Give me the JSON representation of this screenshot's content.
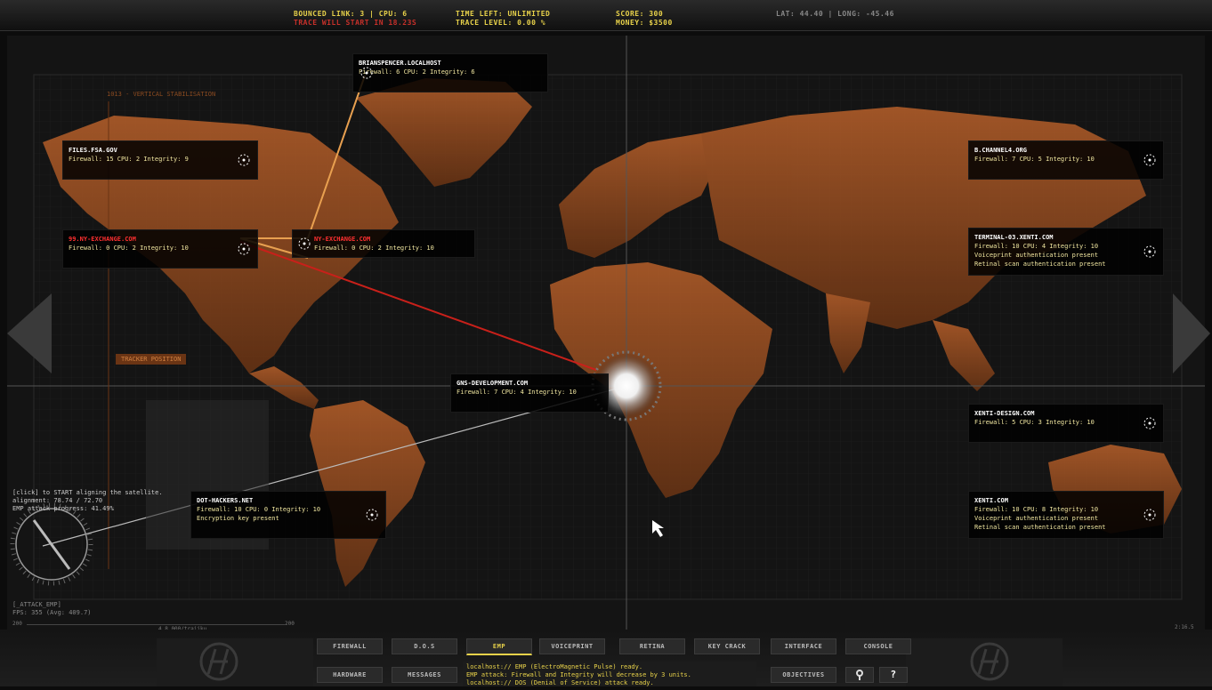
{
  "top": {
    "bounced": "BOUNCED LINK: 3 | CPU: 6",
    "trace_warn": "TRACE WILL START IN 18.23S",
    "time_left": "TIME LEFT: UNLIMITED",
    "trace_level": "TRACE LEVEL: 0.00 %",
    "score": "SCORE: 300",
    "money": "MONEY: $3500",
    "coords": "LAT: 44.40 | LONG: -45.46"
  },
  "map_title": "1013 - VERTICAL STABILISATION",
  "tracker": "TRACKER POSITION",
  "hosts": [
    {
      "name": "BRIANSPENCER.LOCALHOST",
      "lines": [
        "Firewall: 6 CPU: 2 Integrity: 6"
      ]
    },
    {
      "name": "FILES.FSA.GOV",
      "lines": [
        "Firewall: 15 CPU: 2 Integrity: 9"
      ]
    },
    {
      "name": "99.NY-EXCHANGE.COM",
      "lines": [
        "Firewall: 0 CPU: 2 Integrity: 10"
      ]
    },
    {
      "name": "NY-EXCHANGE.COM",
      "lines": [
        "Firewall: 0 CPU: 2 Integrity: 10"
      ]
    },
    {
      "name": "GNS-DEVELOPMENT.COM",
      "lines": [
        "Firewall: 7 CPU: 4 Integrity: 10"
      ]
    },
    {
      "name": "DOT-HACKERS.NET",
      "lines": [
        "Firewall: 10 CPU: 0 Integrity: 10",
        "Encryption key present"
      ]
    },
    {
      "name": "B.CHANNEL4.ORG",
      "lines": [
        "Firewall: 7 CPU: 5 Integrity: 10"
      ]
    },
    {
      "name": "TERMINAL-03.XENTI.COM",
      "lines": [
        "Firewall: 10 CPU: 4 Integrity: 10",
        "Voiceprint authentication present",
        "Retinal scan authentication present"
      ]
    },
    {
      "name": "XENTI-DESIGN.COM",
      "lines": [
        "Firewall: 5 CPU: 3 Integrity: 10"
      ]
    },
    {
      "name": "XENTI.COM",
      "lines": [
        "Firewall: 10 CPU: 8 Integrity: 10",
        "Voiceprint authentication present",
        "Retinal scan authentication present"
      ]
    }
  ],
  "satellite": {
    "line1": "[click] to START aligning the satellite.",
    "line2": "alignment: 78.74 / 72.70",
    "line3": "EMP attack progress: 41.49%"
  },
  "status": {
    "line1": "[_ATTACK_EMP]",
    "line2": "FPS: 355 (Avg: 409.7)",
    "scale_left": "200",
    "scale_right": "200",
    "scale_note": "4.8.000/trajiku",
    "clock": "2:16.5"
  },
  "buttons": {
    "firewall": "FIREWALL",
    "dos": "D.O.S",
    "emp": "EMP",
    "voiceprint": "VOICEPRINT",
    "retina": "RETINA",
    "keycrack": "KEY CRACK",
    "interface": "INTERFACE",
    "console": "CONSOLE",
    "hardware": "HARDWARE",
    "messages": "MESSAGES",
    "objectives": "OBJECTIVES",
    "hint": "?"
  },
  "log": [
    "localhost:// EMP (ElectroMagnetic Pulse) ready.",
    "EMP attack: Firewall and Integrity will decrease by 3 units.",
    "localhost:// DOS (Denial of Service) attack ready."
  ],
  "colors": {
    "accent": "#e8d24a",
    "danger": "#c8302a",
    "land": "#a3521c",
    "ocean": "#141414"
  }
}
